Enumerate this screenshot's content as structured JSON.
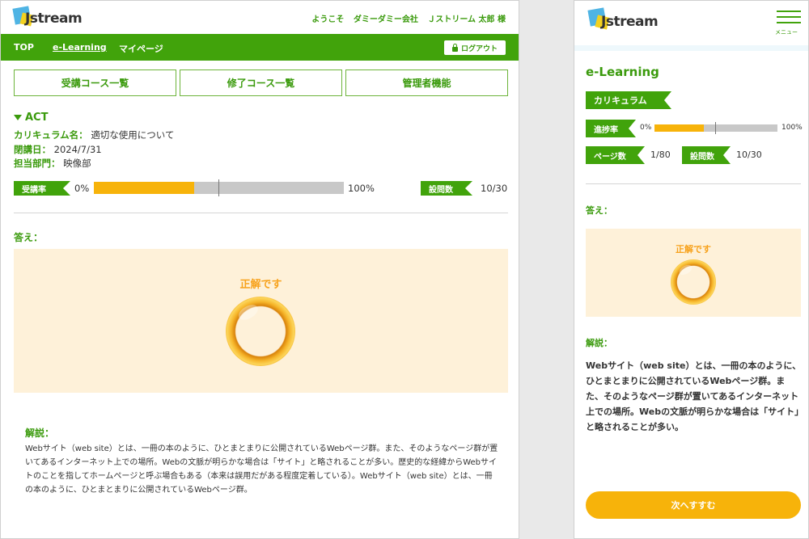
{
  "desktop": {
    "logo_text": "Jstream",
    "welcome": [
      "ようこそ",
      "ダミーダミー会社",
      "Ｊストリーム 太郎 様"
    ],
    "nav": [
      "TOP",
      "e-Learning",
      "マイページ"
    ],
    "logout_label": "ログアウト",
    "tabs": [
      "受講コース一覧",
      "修了コース一覧",
      "管理者機能"
    ],
    "course": {
      "title": "ACT",
      "curriculum_label": "カリキュラム名：",
      "curriculum_value": "適切な使用について",
      "closing_label": "閉講日：",
      "closing_value": "2024/7/31",
      "dept_label": "担当部門：",
      "dept_value": "映像部"
    },
    "progress": {
      "label": "受講率",
      "min": "0%",
      "max": "100%",
      "value_fraction": 0.4,
      "questions_label": "設問数",
      "questions_value": "10/30"
    },
    "answer_label": "答え：",
    "correct_text": "正解です",
    "explanation_label": "解説：",
    "explanation_text": "Webサイト（web site）とは、一冊の本のように、ひとまとまりに公開されているWebページ群。また、そのようなページ群が置いてあるインターネット上での場所。Webの文脈が明らかな場合は「サイト」と略されることが多い。歴史的な経緯からWebサイトのことを指してホームページと呼ぶ場合もある（本来は誤用だがある程度定着している）。Webサイト（web site）とは、一冊の本のように、ひとまとまりに公開されているWebページ群。"
  },
  "mobile": {
    "logo_text": "Jstream",
    "menu_label": "メニュー",
    "title": "e-Learning",
    "curriculum_tag": "カリキュラム",
    "progress": {
      "label": "進捗率",
      "min": "0%",
      "max": "100%",
      "value_fraction": 0.4
    },
    "pages_label": "ページ数",
    "pages_value": "1/80",
    "questions_label": "設問数",
    "questions_value": "10/30",
    "answer_label": "答え：",
    "correct_text": "正解です",
    "explanation_label": "解説：",
    "explanation_text": "Webサイト（web site）とは、一冊の本のように、ひとまとまりに公開されているWebページ群。また、そのようなページ群が置いてあるインターネット上での場所。Webの文脈が明らかな場合は「サイト」と略されることが多い。",
    "next_label": "次へすすむ"
  },
  "colors": {
    "brand_green": "#41a30b",
    "accent_orange": "#f7b30a",
    "answer_bg": "#fef1d9"
  }
}
